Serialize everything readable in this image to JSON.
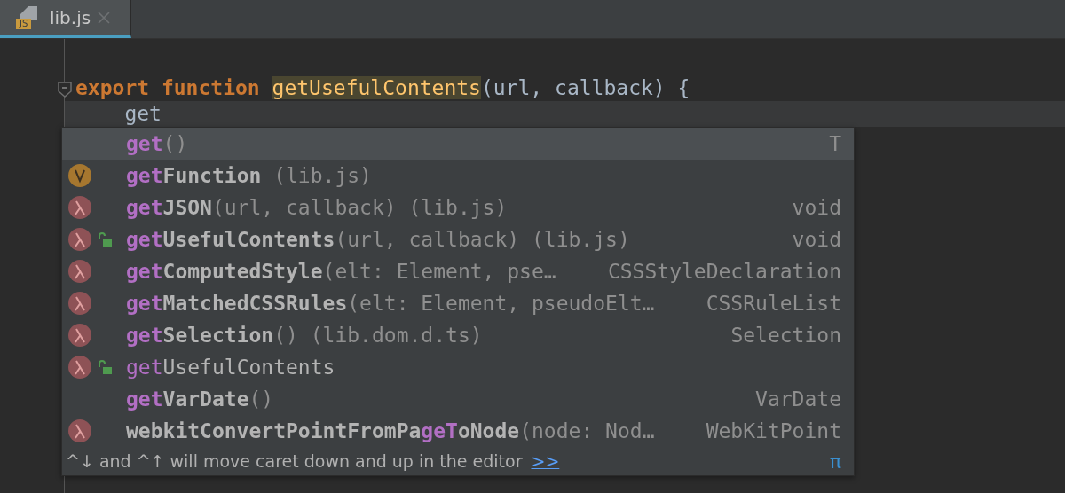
{
  "tab": {
    "label": "lib.js",
    "icon_text": "JS",
    "selected": true
  },
  "code_lines": [
    {
      "fold": true,
      "current": false,
      "segments": [
        {
          "text": "export function ",
          "kind": "keyword"
        },
        {
          "text": "getUsefulContents",
          "kind": "highlight"
        },
        {
          "text": "(url, callback) {",
          "kind": "plain"
        }
      ]
    },
    {
      "fold": false,
      "current": true,
      "segments": [
        {
          "text": "    get",
          "kind": "plain"
        }
      ]
    }
  ],
  "completion": {
    "items": [
      {
        "kind": "plain",
        "lock": false,
        "selected": true,
        "bold": true,
        "name": [
          {
            "text": "get",
            "match": true
          }
        ],
        "tail": "()",
        "type": "T"
      },
      {
        "kind": "variable",
        "lock": false,
        "selected": false,
        "bold": true,
        "name": [
          {
            "text": "get",
            "match": true
          },
          {
            "text": "Function",
            "match": false
          }
        ],
        "tail": " (lib.js)"
      },
      {
        "kind": "method",
        "lock": false,
        "selected": false,
        "bold": true,
        "name": [
          {
            "text": "get",
            "match": true
          },
          {
            "text": "JSON",
            "match": false
          }
        ],
        "tail": "(url, callback) (lib.js)",
        "type": "void"
      },
      {
        "kind": "method",
        "lock": true,
        "selected": false,
        "bold": true,
        "name": [
          {
            "text": "get",
            "match": true
          },
          {
            "text": "UsefulContents",
            "match": false
          }
        ],
        "tail": "(url, callback) (lib.js)",
        "type": "void"
      },
      {
        "kind": "method",
        "lock": false,
        "selected": false,
        "bold": true,
        "name": [
          {
            "text": "get",
            "match": true
          },
          {
            "text": "ComputedStyle",
            "match": false
          }
        ],
        "tail": "(elt: Element, pse…",
        "type": "CSSStyleDeclaration"
      },
      {
        "kind": "method",
        "lock": false,
        "selected": false,
        "bold": true,
        "name": [
          {
            "text": "get",
            "match": true
          },
          {
            "text": "MatchedCSSRules",
            "match": false
          }
        ],
        "tail": "(elt: Element, pseudoElt…",
        "type": "CSSRuleList"
      },
      {
        "kind": "method",
        "lock": false,
        "selected": false,
        "bold": true,
        "name": [
          {
            "text": "get",
            "match": true
          },
          {
            "text": "Selection",
            "match": false
          }
        ],
        "tail": "() (lib.dom.d.ts)",
        "type": "Selection"
      },
      {
        "kind": "method",
        "lock": true,
        "selected": false,
        "bold": false,
        "name": [
          {
            "text": "get",
            "match": true
          },
          {
            "text": "UsefulContents",
            "match": false
          }
        ]
      },
      {
        "kind": "plain",
        "lock": false,
        "selected": false,
        "bold": true,
        "name": [
          {
            "text": "get",
            "match": true
          },
          {
            "text": "VarDate",
            "match": false
          }
        ],
        "tail": "()",
        "type": "VarDate"
      },
      {
        "kind": "method",
        "lock": false,
        "selected": false,
        "bold": true,
        "name": [
          {
            "text": "webkitConvertPointFromPa",
            "match": false
          },
          {
            "text": "ge",
            "match": true
          },
          {
            "text": "T",
            "match": true
          },
          {
            "text": "oNode",
            "match": false
          }
        ],
        "tail": "(node: Nod…",
        "type": "WebKitPoint"
      }
    ],
    "hint": "^↓ and ^↑ will move caret down and up in the editor",
    "hint_link": ">>",
    "corner_button": "π"
  }
}
